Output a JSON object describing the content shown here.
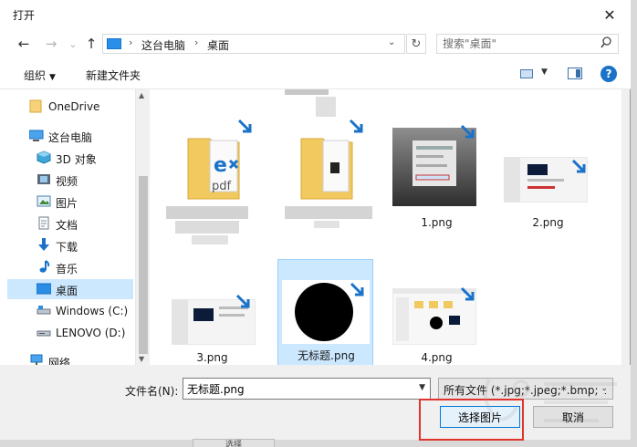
{
  "window": {
    "title": "打开",
    "close_glyph": "✕"
  },
  "nav_buttons": {
    "back": "←",
    "forward": "→",
    "recent": "⌄",
    "up": "↑"
  },
  "address": {
    "segments": [
      "这台电脑",
      "桌面"
    ],
    "separator": "›",
    "dropdown_glyph": "⌄",
    "refresh_glyph": "↻"
  },
  "search": {
    "placeholder": "搜索\"桌面\"",
    "icon": "⌕"
  },
  "toolbar": {
    "organize_label": "组织",
    "new_folder_label": "新建文件夹",
    "help_label": "?"
  },
  "sidebar": {
    "items": [
      {
        "label": "OneDrive",
        "icon": "folder-icon"
      },
      {
        "label": "这台电脑",
        "icon": "computer-icon"
      },
      {
        "label": "3D 对象",
        "icon": "cube-icon"
      },
      {
        "label": "视频",
        "icon": "video-icon"
      },
      {
        "label": "图片",
        "icon": "image-icon"
      },
      {
        "label": "文档",
        "icon": "document-icon"
      },
      {
        "label": "下载",
        "icon": "download-icon"
      },
      {
        "label": "音乐",
        "icon": "music-icon"
      },
      {
        "label": "桌面",
        "icon": "desktop-icon",
        "selected": true
      },
      {
        "label": "Windows (C:)",
        "icon": "drive-icon"
      },
      {
        "label": "LENOVO (D:)",
        "icon": "drive-icon"
      },
      {
        "label": "网络",
        "icon": "network-icon"
      }
    ]
  },
  "files": [
    {
      "name": "1.png"
    },
    {
      "name": "2.png"
    },
    {
      "name": "3.png"
    },
    {
      "name": "无标题.png",
      "selected": true
    },
    {
      "name": "4.png"
    }
  ],
  "footer": {
    "filename_label": "文件名(N):",
    "filename_value": "无标题.png",
    "filetype_value": "所有文件 (*.jpg;*.jpeg;*.bmp;*.",
    "dropdown_glyph": "⌄",
    "open_button": "选择图片",
    "cancel_button": "取消",
    "behind_button": "选择"
  },
  "colors": {
    "selection": "#cce8ff",
    "accent": "#0078d7",
    "highlight_box": "#e0332e"
  }
}
